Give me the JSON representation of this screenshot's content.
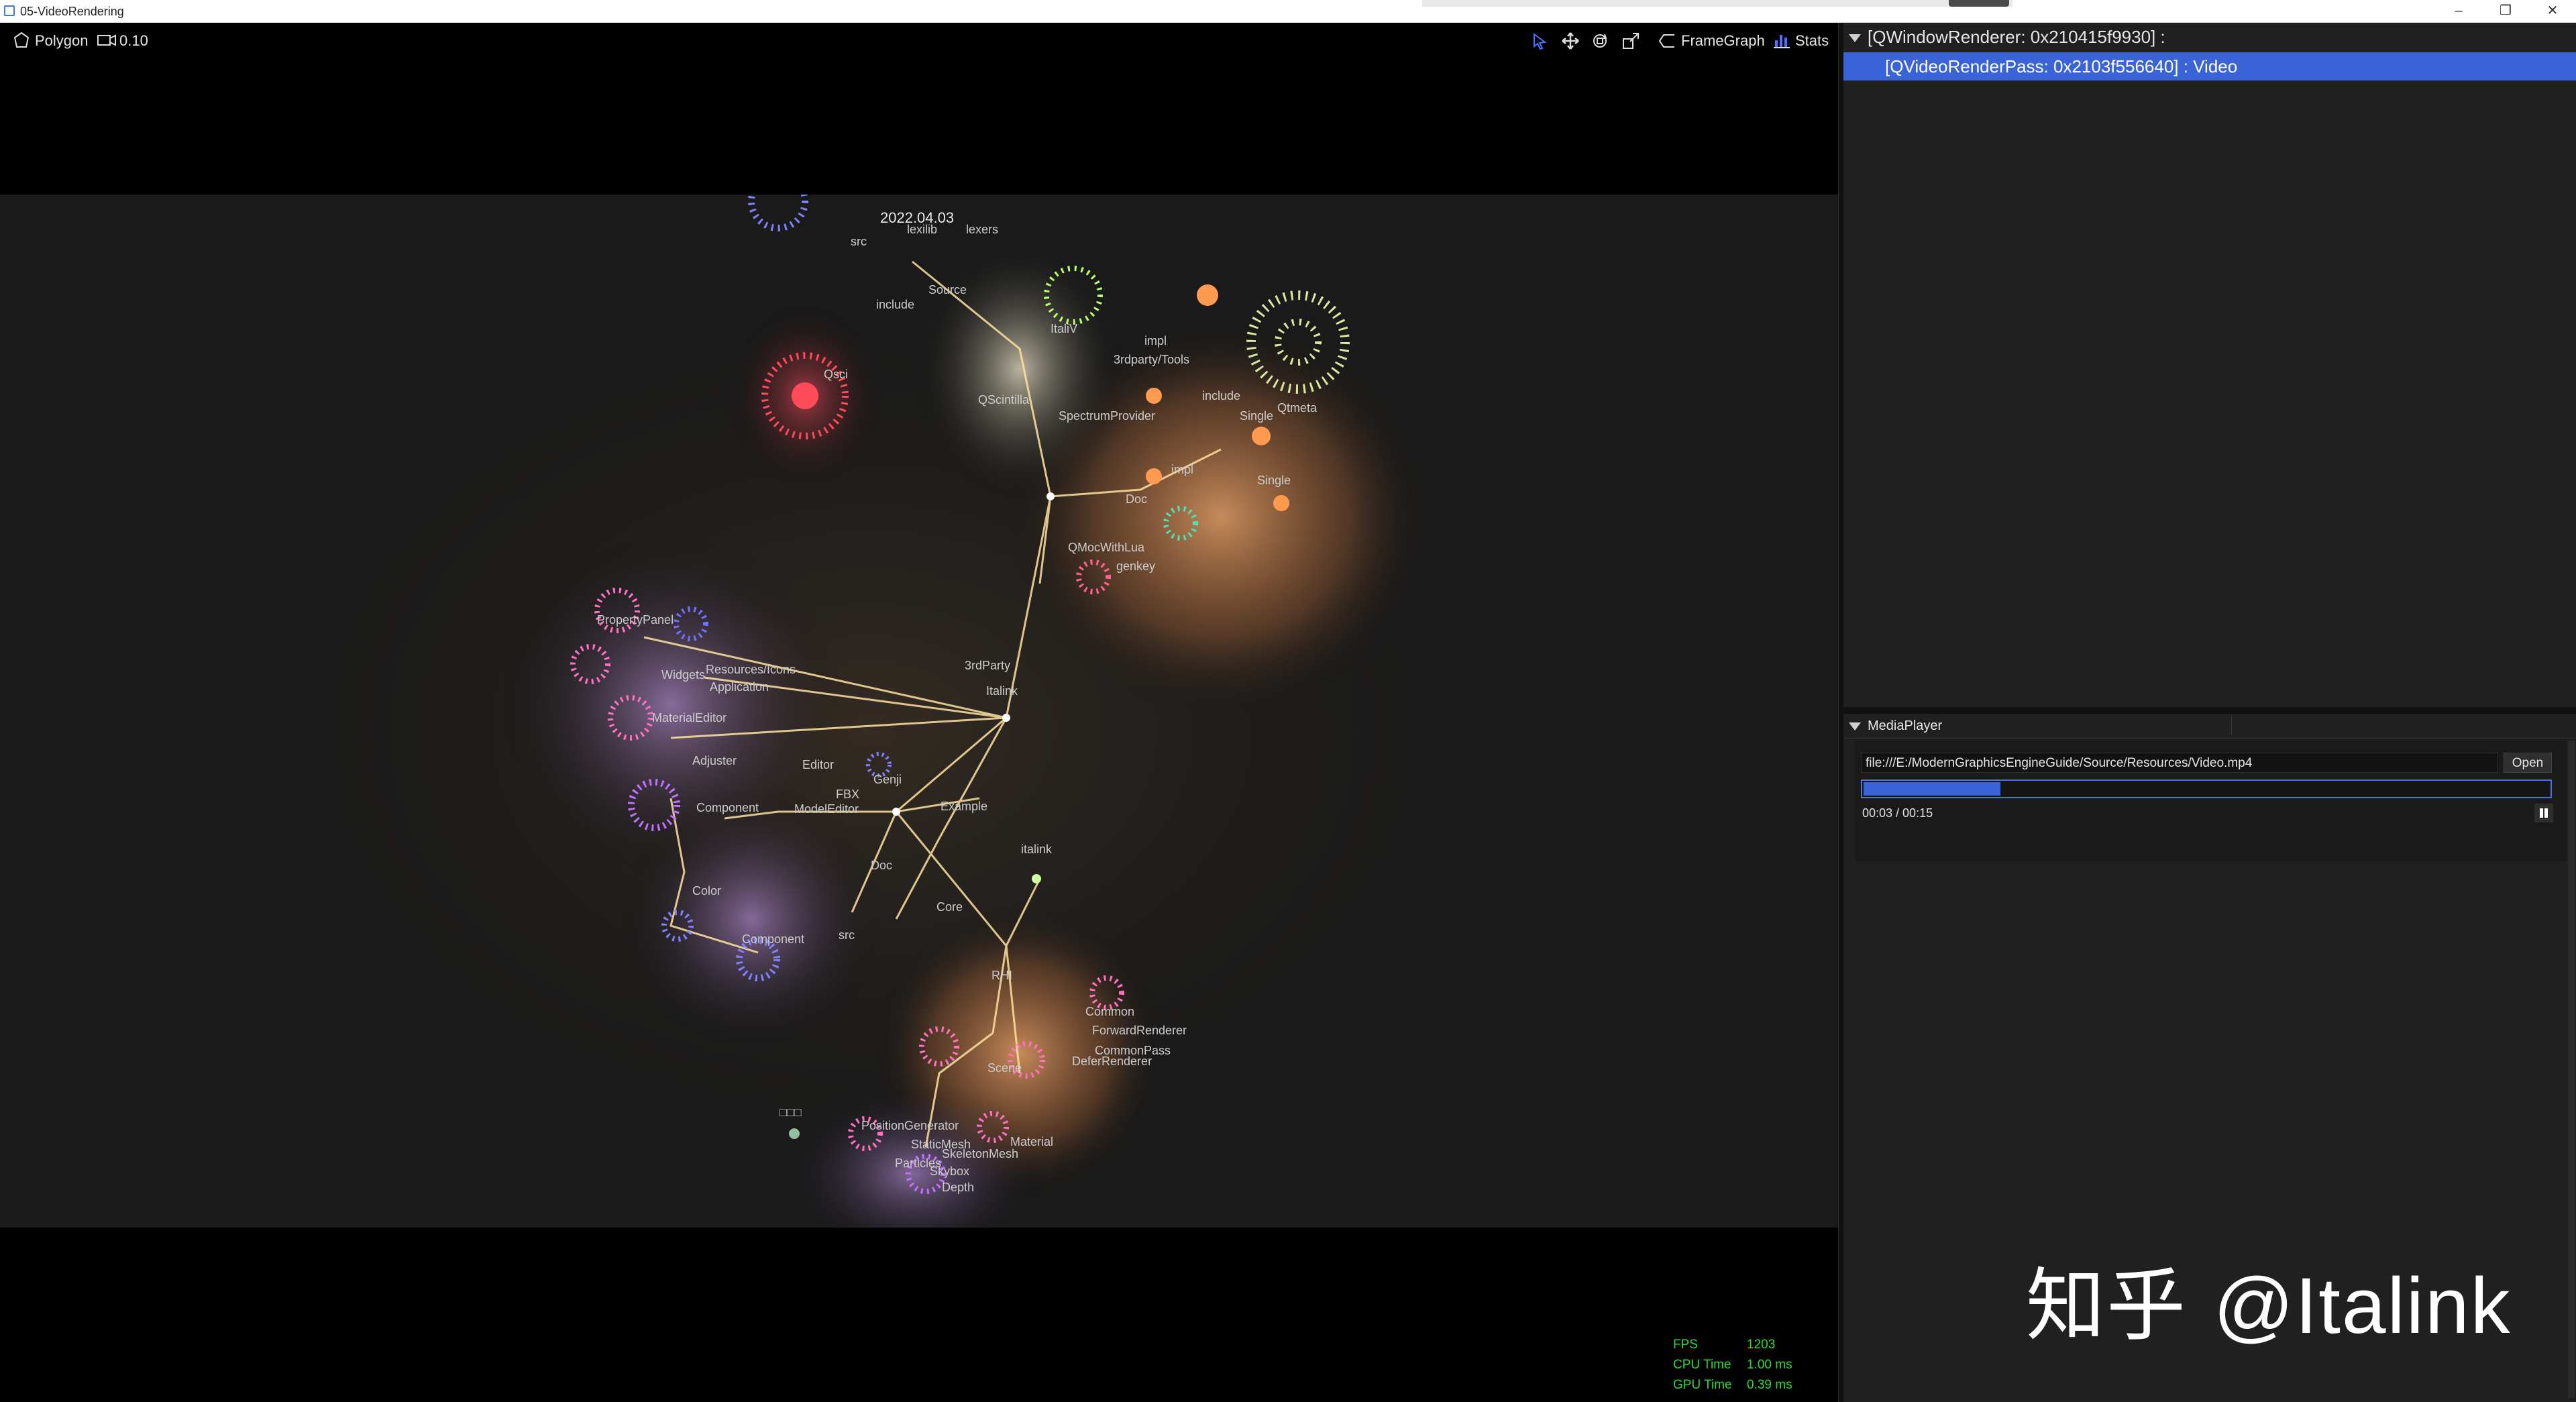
{
  "window": {
    "title": "05-VideoRendering",
    "controls": {
      "minimize": "–",
      "maximize": "❐",
      "close": "✕"
    }
  },
  "viewport_toolbar": {
    "mode_label": "Polygon",
    "camera_speed": "0.10",
    "tools": [
      {
        "name": "select-tool",
        "icon": "cursor-icon",
        "active": true
      },
      {
        "name": "translate-tool",
        "icon": "move-icon"
      },
      {
        "name": "rotate-tool",
        "icon": "rotate-icon"
      },
      {
        "name": "scale-tool",
        "icon": "scale-icon"
      }
    ],
    "framegraph_label": "FrameGraph",
    "stats_label": "Stats"
  },
  "scene": {
    "date_label": "2022.04.03",
    "labels": [
      "2022.04.03",
      "lexilib",
      "lexers",
      "src",
      "include",
      "Source",
      "Qsci",
      "ItaliV",
      "impl",
      "3rdparty/Tools",
      "SpectrumProvider",
      "QScintilla",
      "include",
      "Single",
      "Qtmeta",
      "Single",
      "impl",
      "Doc",
      "QMocWithLua",
      "genkey",
      "3rdParty",
      "Italink",
      "PropertyPanel",
      "Resources/Icons",
      "Application",
      "Widgets",
      "MaterialEditor",
      "Adjuster",
      "Editor",
      "Genji",
      "FBX",
      "ModelEditor",
      "Example",
      "Component",
      "Doc",
      "italink",
      "Color",
      "Core",
      "src",
      "Component",
      "RHI",
      "Common",
      "ForwardRenderer",
      "CommonPass",
      "DeferRenderer",
      "Scene",
      "□□□",
      "PositionGenerator",
      "StaticMesh",
      "SkeletonMesh",
      "Material",
      "Particles",
      "Skybox",
      "Depth"
    ]
  },
  "stats": {
    "fps_label": "FPS",
    "fps": "1203",
    "cpu_label": "CPU Time",
    "cpu": "1.00 ms",
    "gpu_label": "GPU Time",
    "gpu": "0.39 ms"
  },
  "outline": {
    "root": "[QWindowRenderer: 0x210415f9930] :",
    "child": "[QVideoRenderPass: 0x2103f556640] : Video"
  },
  "media_player": {
    "title": "MediaPlayer",
    "url": "file:///E:/ModernGraphicsEngineGuide/Source/Resources/Video.mp4",
    "open_label": "Open",
    "progress": 0.2,
    "time": "00:03 / 00:15"
  },
  "watermark": {
    "cn": "知乎",
    "handle": "@Italink"
  },
  "colors": {
    "accent": "#3a63d8",
    "stats_green": "#2bdc3a",
    "panel_bg": "#202020",
    "viewport_bg": "#000000"
  }
}
